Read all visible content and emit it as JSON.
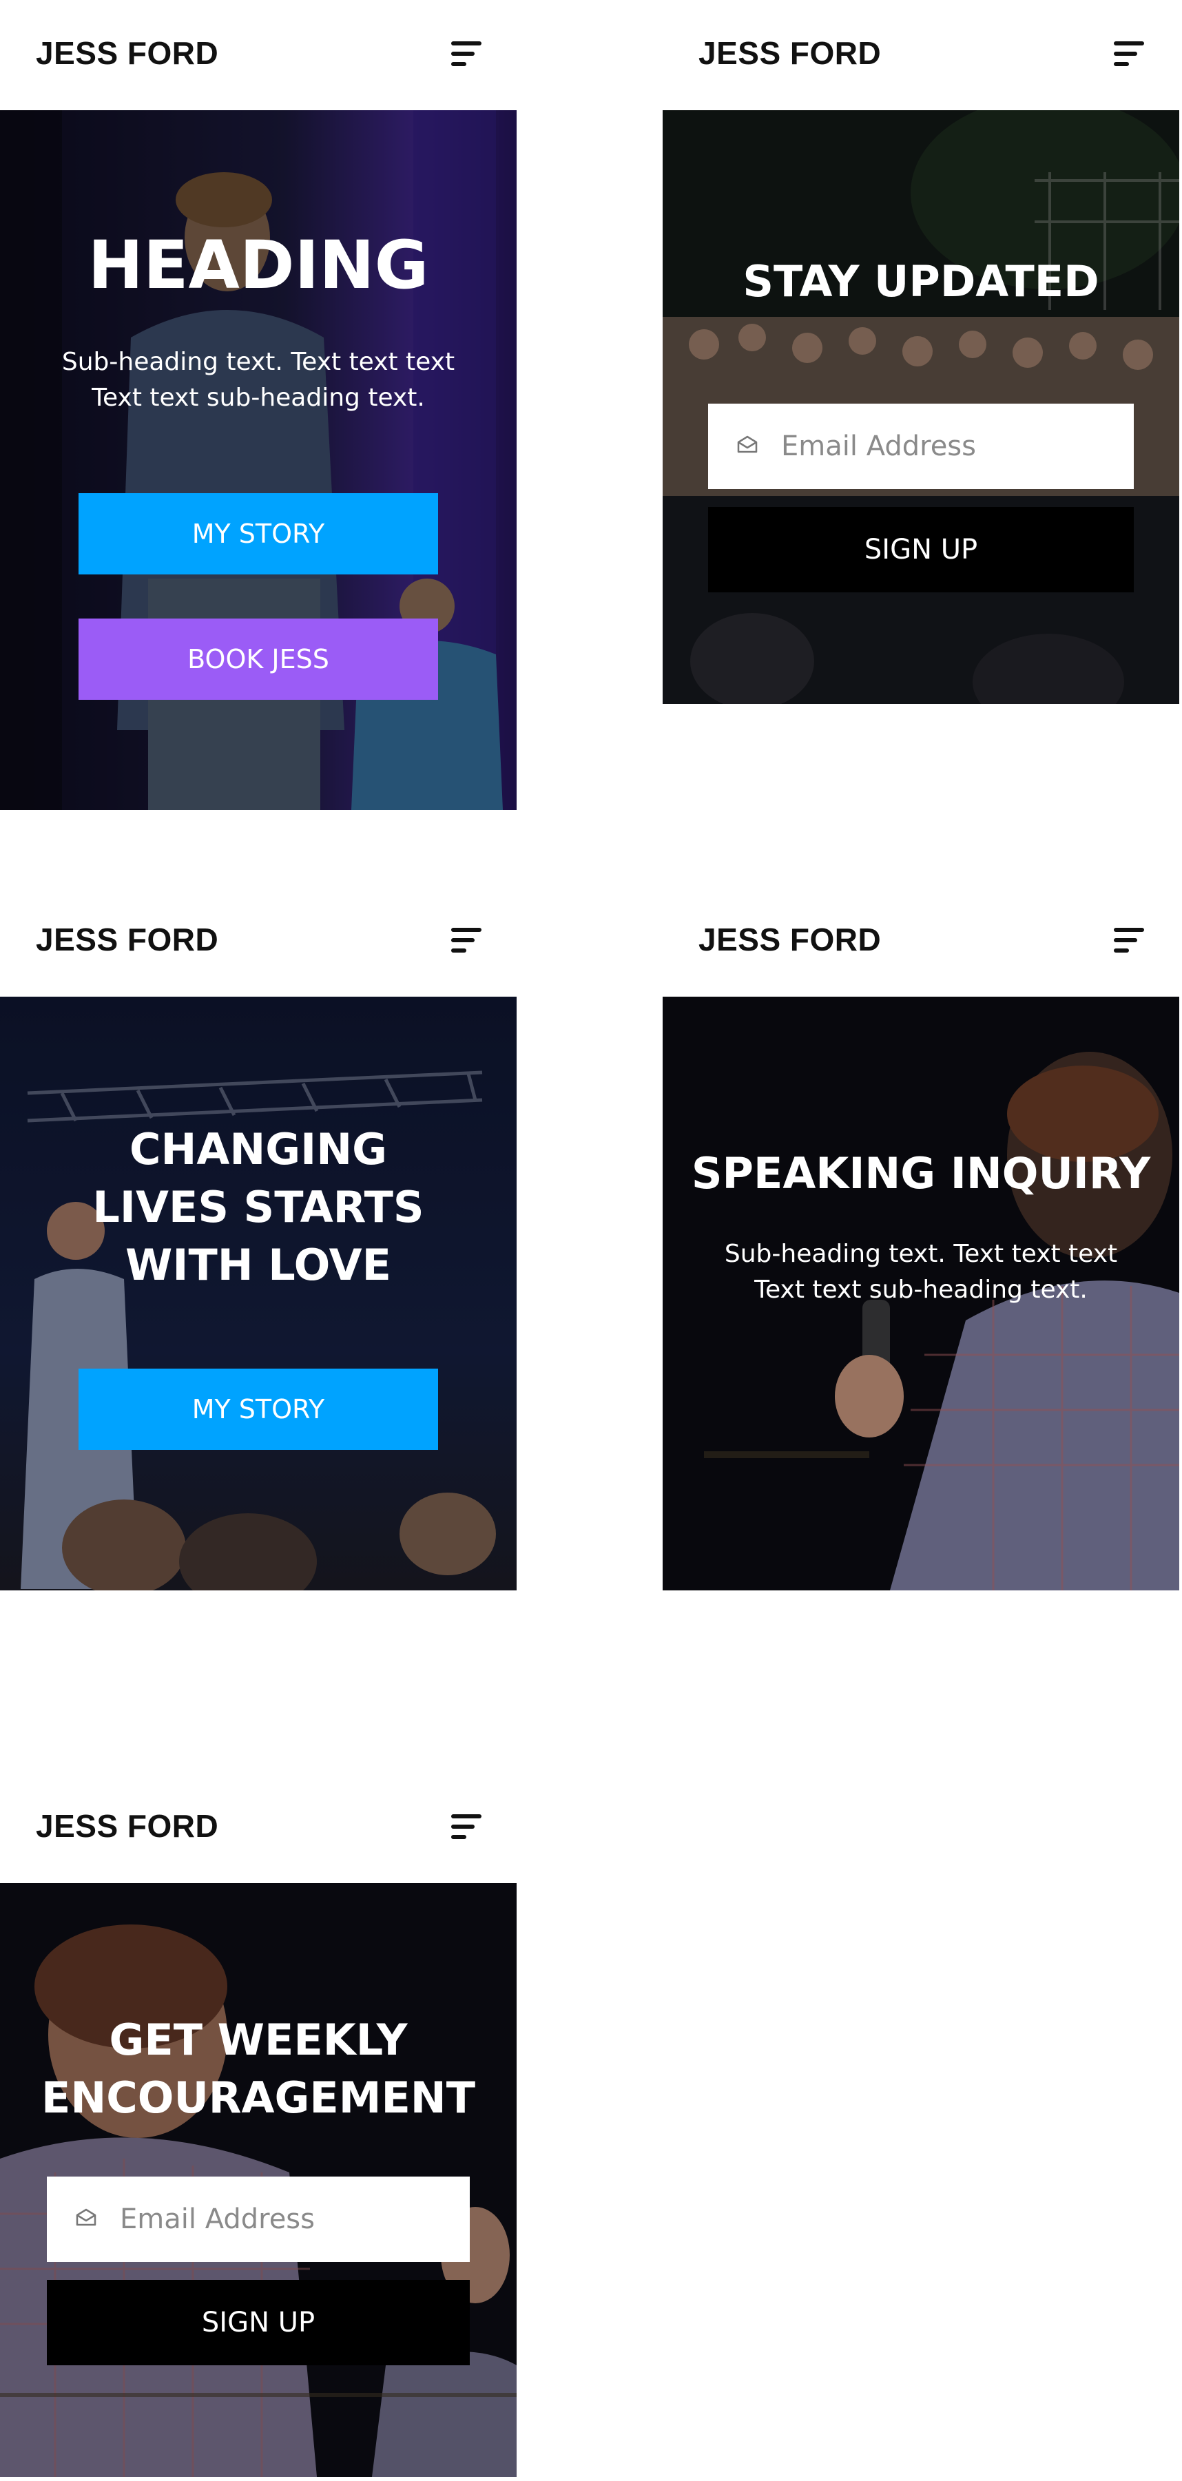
{
  "brand": "JESS FORD",
  "colors": {
    "blue": "#00a3ff",
    "purple": "#9b5cf6",
    "black": "#000000"
  },
  "icons": {
    "menu": "hamburger-icon",
    "mail": "envelope-icon"
  },
  "screens": {
    "one": {
      "heading": "HEADING",
      "subheading": "Sub-heading text. Text text text Text text sub-heading text.",
      "button_primary": "MY STORY",
      "button_secondary": "BOOK JESS"
    },
    "two": {
      "heading": "STAY UPDATED",
      "email_placeholder": "Email Address",
      "button": "SIGN UP"
    },
    "three": {
      "heading": "CHANGING LIVES STARTS WITH LOVE",
      "button": "MY STORY"
    },
    "four": {
      "heading": "SPEAKING INQUIRY",
      "subheading": "Sub-heading text. Text text text Text text sub-heading text."
    },
    "five": {
      "heading": "GET WEEKLY ENCOURAGEMENT",
      "email_placeholder": "Email Address",
      "button": "SIGN UP"
    }
  }
}
